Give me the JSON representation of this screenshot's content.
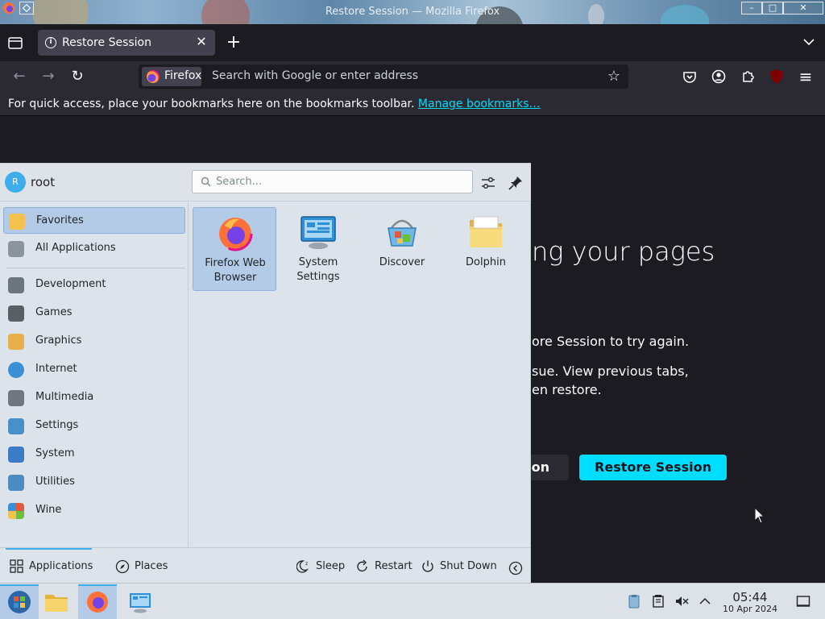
{
  "window": {
    "title": "Restore Session — Mozilla Firefox",
    "controls": {
      "minimize": "–",
      "maximize": "□",
      "close": "✕"
    }
  },
  "tabs": {
    "active_title": "Restore Session",
    "close_glyph": "✕",
    "new_tab_glyph": "+"
  },
  "navbar": {
    "back_glyph": "←",
    "forward_glyph": "→",
    "reload_glyph": "↻",
    "identity_label": "Firefox",
    "url_placeholder": "Search with Google or enter address",
    "star_glyph": "☆",
    "menu_glyph": "≡",
    "ublock_label": "uO"
  },
  "bookmarks_bar": {
    "text": "For quick access, place your bookmarks here on the bookmarks toolbar.",
    "link": "Manage bookmarks…"
  },
  "page": {
    "heading_visible": "ng your pages",
    "line1_visible": "ore Session to try again.",
    "line2_visible": "sue. View previous tabs,",
    "line3_visible": "en restore.",
    "new_session_visible": "sion",
    "restore_button": "Restore Session"
  },
  "kickoff": {
    "user": "root",
    "avatar_letter": "R",
    "search_placeholder": "Search...",
    "categories": [
      {
        "label": "Favorites",
        "icon": "favorites-icon",
        "color": "#f2c14e",
        "active": true
      },
      {
        "label": "All Applications",
        "icon": "all-applications-icon",
        "color": "#8b949c",
        "active": false
      },
      {
        "label": "Development",
        "icon": "development-icon",
        "color": "#6b7580",
        "active": false
      },
      {
        "label": "Games",
        "icon": "games-icon",
        "color": "#5a5f66",
        "active": false
      },
      {
        "label": "Graphics",
        "icon": "graphics-icon",
        "color": "#e8b04a",
        "active": false
      },
      {
        "label": "Internet",
        "icon": "internet-icon",
        "color": "#3a8fd6",
        "active": false
      },
      {
        "label": "Multimedia",
        "icon": "multimedia-icon",
        "color": "#70767d",
        "active": false
      },
      {
        "label": "Settings",
        "icon": "settings-icon",
        "color": "#4a90c8",
        "active": false
      },
      {
        "label": "System",
        "icon": "system-icon",
        "color": "#3b7cc4",
        "active": false
      },
      {
        "label": "Utilities",
        "icon": "utilities-icon",
        "color": "#4d8bc0",
        "active": false
      },
      {
        "label": "Wine",
        "icon": "wine-icon",
        "color": "#e25a3b",
        "active": false
      }
    ],
    "apps": [
      {
        "label_line1": "Firefox Web",
        "label_line2": "Browser",
        "icon": "firefox-icon",
        "active": true
      },
      {
        "label_line1": "System",
        "label_line2": "Settings",
        "icon": "system-settings-icon",
        "active": false
      },
      {
        "label_line1": "Discover",
        "label_line2": "",
        "icon": "discover-icon",
        "active": false
      },
      {
        "label_line1": "Dolphin",
        "label_line2": "",
        "icon": "dolphin-icon",
        "active": false
      }
    ],
    "footer": {
      "applications": "Applications",
      "places": "Places",
      "sleep": "Sleep",
      "restart": "Restart",
      "shutdown": "Shut Down"
    }
  },
  "taskbar": {
    "time": "05:44",
    "date": "10 Apr 2024"
  },
  "colors": {
    "accent_cyan": "#00ddff",
    "kde_blue": "#3daee9",
    "kde_selection": "#b4cbe8",
    "page_bg": "#1c1b22",
    "toolbar_bg": "#2b2a33"
  }
}
